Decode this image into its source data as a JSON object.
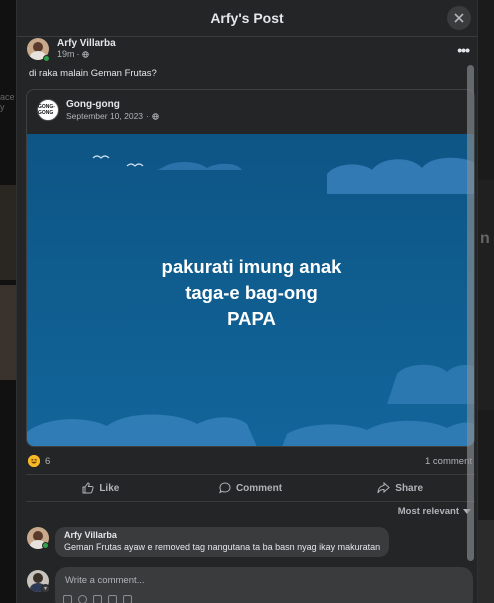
{
  "modal": {
    "title": "Arfy's Post"
  },
  "post": {
    "author": "Arfy Villarba",
    "time": "19m",
    "text": "di raka malain Geman Frutas?",
    "shared": {
      "page_name": "Gong-gong",
      "page_logo_text": "GONG-GONG",
      "date": "September 10, 2023",
      "image_lines": [
        "pakurati imung anak",
        "taga-e bag-ong",
        "PAPA"
      ]
    },
    "reactions_count": "6",
    "comments_count": "1 comment"
  },
  "actions": {
    "like": "Like",
    "comment": "Comment",
    "share": "Share"
  },
  "sort_label": "Most relevant",
  "comments": [
    {
      "author": "Arfy Villarba",
      "text": "Geman Frutas ayaw e removed tag nangutana ta ba basn nyag ikay makuratan"
    }
  ],
  "composer": {
    "placeholder": "Write a comment..."
  },
  "background": {
    "left_text": "ace\ny",
    "right_text": "n"
  },
  "colors": {
    "modal_bg": "#242526",
    "image_bg": "#0f5b8c",
    "online": "#31a24c",
    "reaction": "#f7b928"
  }
}
